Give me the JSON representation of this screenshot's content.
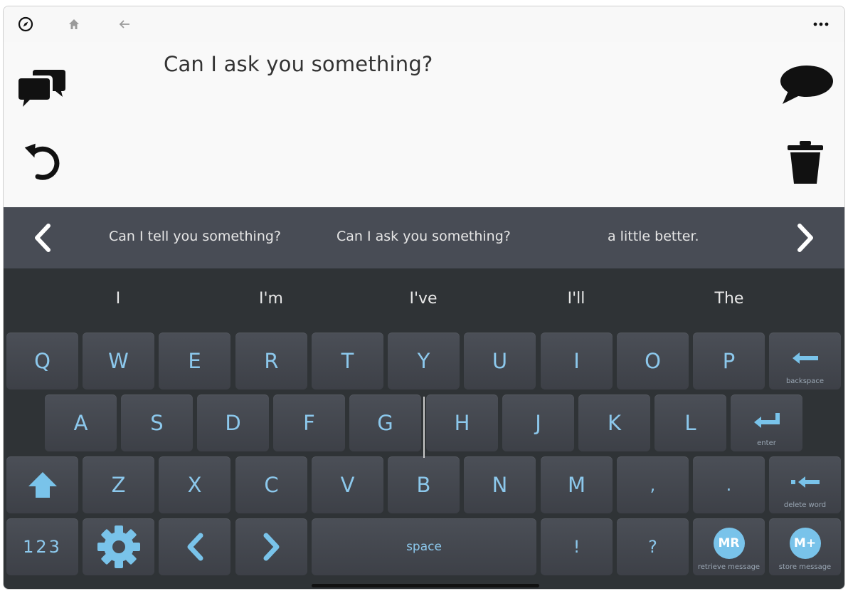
{
  "message": {
    "text": "Can I ask you something?"
  },
  "phrases": {
    "items": [
      "Can I tell you something?",
      "Can I ask you something?",
      "a little better."
    ]
  },
  "words": {
    "items": [
      "I",
      "I'm",
      "I've",
      "I'll",
      "The"
    ]
  },
  "keyboard": {
    "row1": [
      "Q",
      "W",
      "E",
      "R",
      "T",
      "Y",
      "U",
      "I",
      "O",
      "P"
    ],
    "row2": [
      "A",
      "S",
      "D",
      "F",
      "G",
      "H",
      "J",
      "K",
      "L"
    ],
    "row3": [
      "Z",
      "X",
      "C",
      "V",
      "B",
      "N",
      "M",
      ",",
      "."
    ],
    "backspace_label": "backspace",
    "enter_label": "enter",
    "delete_word_label": "delete word",
    "numbers_label": "123",
    "space_label": "space",
    "exclaim_label": "!",
    "question_label": "?",
    "retrieve_short": "MR",
    "retrieve_label": "retrieve message",
    "store_short": "M+",
    "store_label": "store message"
  },
  "icons": {
    "compass": "compass-icon",
    "home": "home-icon",
    "back": "back-arrow-icon",
    "more": "more-icon",
    "chat": "chat-bubbles-icon",
    "undo": "undo-icon",
    "speak": "speech-bubble-icon",
    "trash": "trash-icon"
  },
  "colors": {
    "accent": "#79c3ea",
    "key_text": "#8cc8ec",
    "phrase_bar": "#484c55",
    "keyboard_bg": "#2f3336"
  }
}
